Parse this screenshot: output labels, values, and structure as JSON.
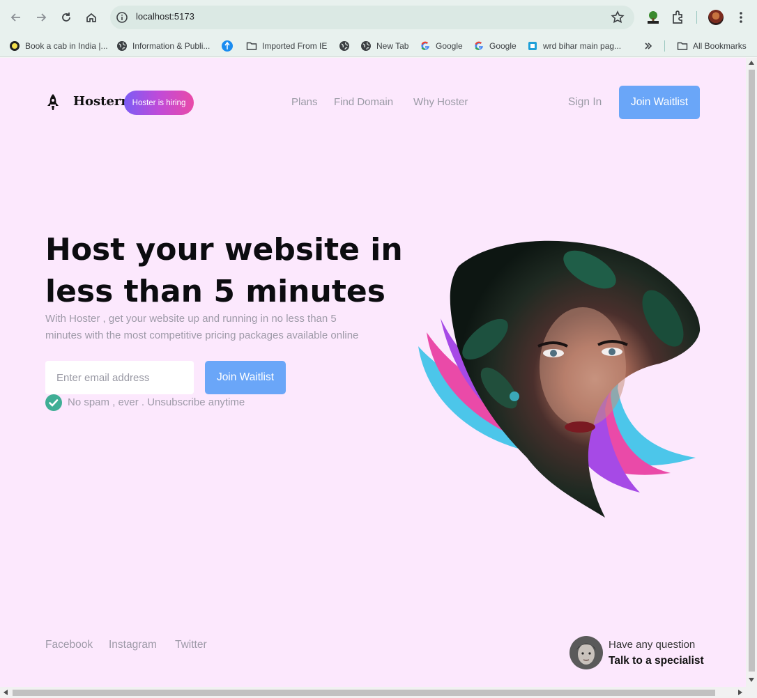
{
  "browser": {
    "url": "localhost:5173",
    "bookmarks": [
      {
        "label": "Book a cab in India |...",
        "icon": "cab-favicon"
      },
      {
        "label": "Information & Publi...",
        "icon": "globe-icon"
      },
      {
        "label": "",
        "icon": "blue-favicon"
      },
      {
        "label": "Imported From IE",
        "icon": "folder-icon"
      },
      {
        "label": "",
        "icon": "globe-icon"
      },
      {
        "label": "New Tab",
        "icon": "globe-icon"
      },
      {
        "label": "Google",
        "icon": "google-icon"
      },
      {
        "label": "Google",
        "icon": "google-icon"
      },
      {
        "label": "wrd bihar main pag...",
        "icon": "bihar-favicon"
      }
    ],
    "all_bookmarks": "All Bookmarks"
  },
  "header": {
    "brand": "Hosterr",
    "hiring_badge": "Hoster is hiring",
    "nav": [
      "Plans",
      "Find Domain",
      "Why Hoster"
    ],
    "sign_in": "Sign In",
    "join_waitlist": "Join Waitlist"
  },
  "hero": {
    "headline_line1": "Host your website in",
    "headline_line2": "less than 5 minutes",
    "subtext": "With Hoster , get your website up and running in no less than 5 minutes with the most competitive pricing packages available online",
    "email_placeholder": "Enter email address",
    "join_waitlist": "Join Waitlist",
    "no_spam": "No spam , ever . Unsubscribe anytime"
  },
  "footer": {
    "social": [
      "Facebook",
      "Instagram",
      "Twitter"
    ],
    "question": "Have any question",
    "specialist": "Talk to a specialist"
  },
  "colors": {
    "page_bg": "#fce8fd",
    "accent_blue": "#6aa6f8",
    "cyan": "#4cc6ea",
    "pink": "#ea4aa8",
    "purple": "#a64ae6"
  }
}
